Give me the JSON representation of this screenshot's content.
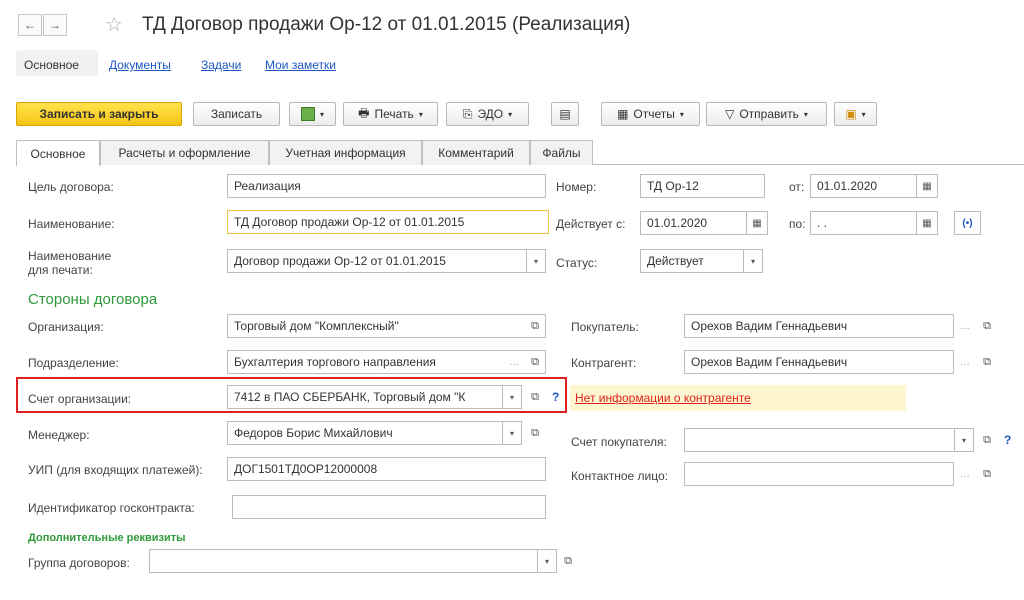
{
  "window": {
    "title": "ТД Договор продажи Ор-12 от 01.01.2015 (Реализация)",
    "back_icon": "←",
    "forward_icon": "→",
    "star_icon": "☆"
  },
  "topnav": {
    "items": [
      "Основное",
      "Документы",
      "Задачи",
      "Мои заметки"
    ]
  },
  "toolbar": {
    "save_close": "Записать и закрыть",
    "save": "Записать",
    "print": "Печать",
    "edo": "ЭДО",
    "reports": "Отчеты",
    "send": "Отправить"
  },
  "tabs": [
    "Основное",
    "Расчеты и оформление",
    "Учетная информация",
    "Комментарий",
    "Файлы"
  ],
  "form": {
    "purpose_label": "Цель договора:",
    "purpose_value": "Реализация",
    "name_label": "Наименование:",
    "name_value": "ТД Договор продажи Ор-12 от 01.01.2015",
    "print_name_label": "Наименование\nдля печати:",
    "print_name_value": "Договор продажи Ор-12 от 01.01.2015",
    "number_label": "Номер:",
    "number_value": "ТД Ор-12",
    "from_label": "от:",
    "from_value": "01.01.2020",
    "valid_from_label": "Действует с:",
    "valid_from_value": "01.01.2020",
    "to_label": "по:",
    "to_value": " .  .",
    "status_label": "Статус:",
    "status_value": "Действует",
    "parties_title": "Стороны договора",
    "org_label": "Организация:",
    "org_value": "Торговый дом \"Комплексный\"",
    "dept_label": "Подразделение:",
    "dept_value": "Бухгалтерия торгового направления",
    "account_label": "Счет организации:",
    "account_value": "7412 в ПАО СБЕРБАНК, Торговый дом \"К",
    "manager_label": "Менеджер:",
    "manager_value": "Федоров Борис Михайлович",
    "uip_label": "УИП (для входящих платежей):",
    "uip_value": "ДОГ1501ТД0ОР12000008",
    "gov_label": "Идентификатор госконтракта:",
    "gov_value": "",
    "buyer_label": "Покупатель:",
    "buyer_value": "Орехов Вадим Геннадьевич",
    "contractor_label": "Контрагент:",
    "contractor_value": "Орехов Вадим Геннадьевич",
    "no_info_link": "Нет информации о контрагенте",
    "buyer_account_label": "Счет покупателя:",
    "buyer_account_value": "",
    "contact_label": "Контактное лицо:",
    "contact_value": "",
    "extra_title": "Дополнительные реквизиты",
    "group_label": "Группа договоров:",
    "group_value": ""
  },
  "colors": {
    "accent_green": "#2e9a3a",
    "link_blue": "#1c56c4",
    "highlight_red": "#e02020",
    "primary_yellow": "#f5c515"
  }
}
